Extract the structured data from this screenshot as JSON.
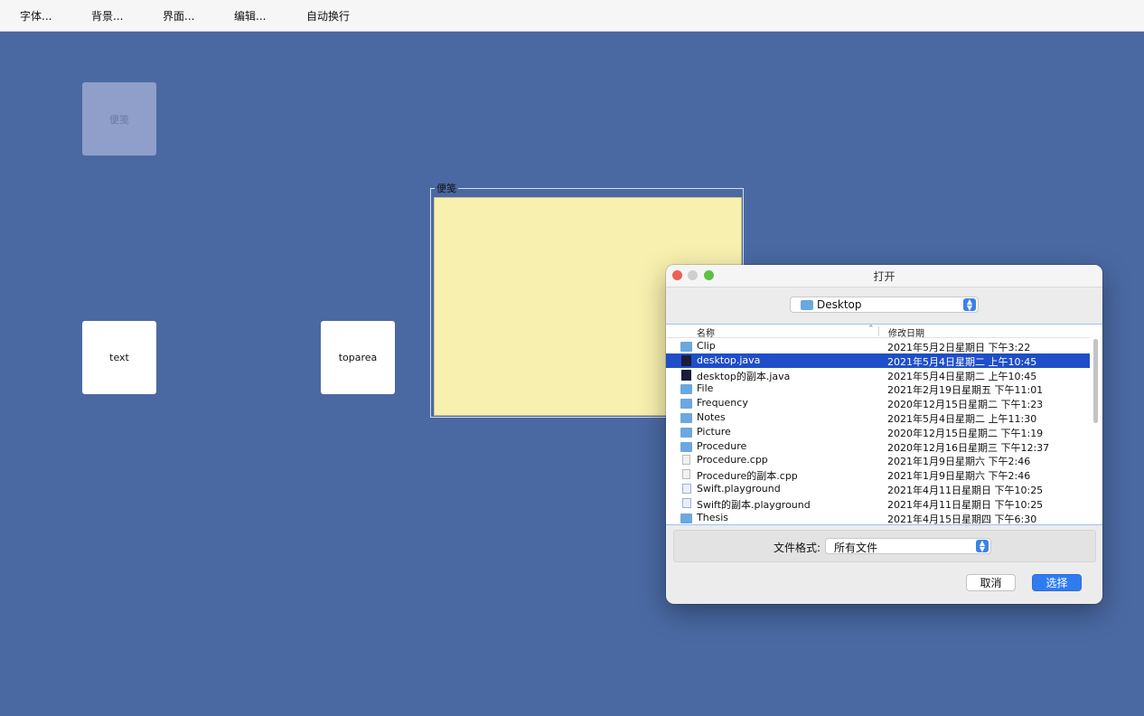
{
  "menubar": {
    "items": [
      "字体...",
      "背景...",
      "界面...",
      "编辑...",
      "自动换行"
    ]
  },
  "tiles": {
    "ghost_label": "便笺",
    "text_label": "text",
    "toparea_label": "toparea"
  },
  "note": {
    "title": "便笺"
  },
  "dialog": {
    "title": "打开",
    "location": "Desktop",
    "columns": {
      "name": "名称",
      "date": "修改日期"
    },
    "files": [
      {
        "name": "Clip",
        "date": "2021年5月2日星期日 下午3:22",
        "type": "folder"
      },
      {
        "name": "desktop.java",
        "date": "2021年5月4日星期二 上午10:45",
        "type": "java",
        "selected": true
      },
      {
        "name": "desktop的副本.java",
        "date": "2021年5月4日星期二 上午10:45",
        "type": "java"
      },
      {
        "name": "File",
        "date": "2021年2月19日星期五 下午11:01",
        "type": "folder"
      },
      {
        "name": "Frequency",
        "date": "2020年12月15日星期二 下午1:23",
        "type": "folder"
      },
      {
        "name": "Notes",
        "date": "2021年5月4日星期二 上午11:30",
        "type": "folder"
      },
      {
        "name": "Picture",
        "date": "2020年12月15日星期二 下午1:19",
        "type": "folder"
      },
      {
        "name": "Procedure",
        "date": "2020年12月16日星期三 下午12:37",
        "type": "folder"
      },
      {
        "name": "Procedure.cpp",
        "date": "2021年1月9日星期六 下午2:46",
        "type": "cpp"
      },
      {
        "name": "Procedure的副本.cpp",
        "date": "2021年1月9日星期六 下午2:46",
        "type": "cpp"
      },
      {
        "name": "Swift.playground",
        "date": "2021年4月11日星期日 下午10:25",
        "type": "swift"
      },
      {
        "name": "Swift的副本.playground",
        "date": "2021年4月11日星期日 下午10:25",
        "type": "swift"
      },
      {
        "name": "Thesis",
        "date": "2021年4月15日星期四 下午6:30",
        "type": "folder"
      }
    ],
    "format_label": "文件格式:",
    "format_value": "所有文件",
    "cancel_label": "取消",
    "ok_label": "选择"
  },
  "colors": {
    "desktop_bg": "#4a69a3",
    "note_bg": "#f8f0ae",
    "selection": "#1f4ec9",
    "accent_button": "#2f7cf0"
  }
}
